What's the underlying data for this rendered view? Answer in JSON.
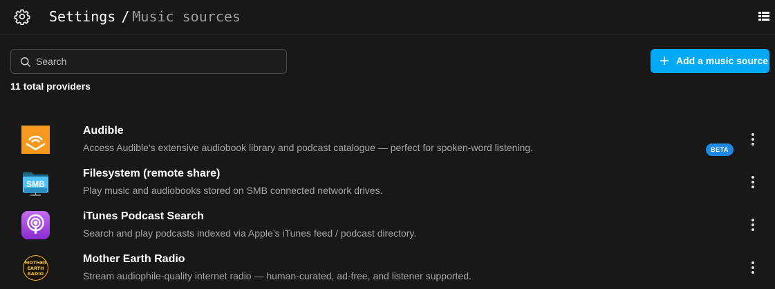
{
  "header": {
    "breadcrumb_root": "Settings",
    "breadcrumb_separator": "/",
    "breadcrumb_current": "Music sources",
    "icons": {
      "settings": "gear-icon",
      "view_toggle": "list-view-icon"
    }
  },
  "search": {
    "placeholder": "Search",
    "value": ""
  },
  "toolbar": {
    "add_label": "Add a music source",
    "accent_color": "#03a9f4"
  },
  "summary": {
    "count_text": "11 total providers"
  },
  "providers": [
    {
      "name": "Audible",
      "description": "Access Audible's extensive audiobook library and podcast catalogue — perfect for spoken-word listening.",
      "icon": "audible-logo",
      "color": "#f7991c"
    },
    {
      "name": "Filesystem (remote share)",
      "description": "Play music and audiobooks stored on SMB connected network drives.",
      "icon": "smb-folder-logo",
      "logo_text": "SMB",
      "color": "#4fc3f7"
    },
    {
      "name": "iTunes Podcast Search",
      "description": "Search and play podcasts indexed via Apple’s iTunes feed / podcast directory.",
      "icon": "podcasts-logo",
      "color": "#a53fd7"
    },
    {
      "name": "Mother Earth Radio",
      "description": "Stream audiophile-quality internet radio — human-curated, ad-free, and listener supported.",
      "icon": "mother-earth-radio-logo",
      "badge": "BETA",
      "badge_color": "#1e88e5",
      "logo_lines": [
        "MOTHER",
        "EARTH",
        "RADIO"
      ]
    }
  ]
}
